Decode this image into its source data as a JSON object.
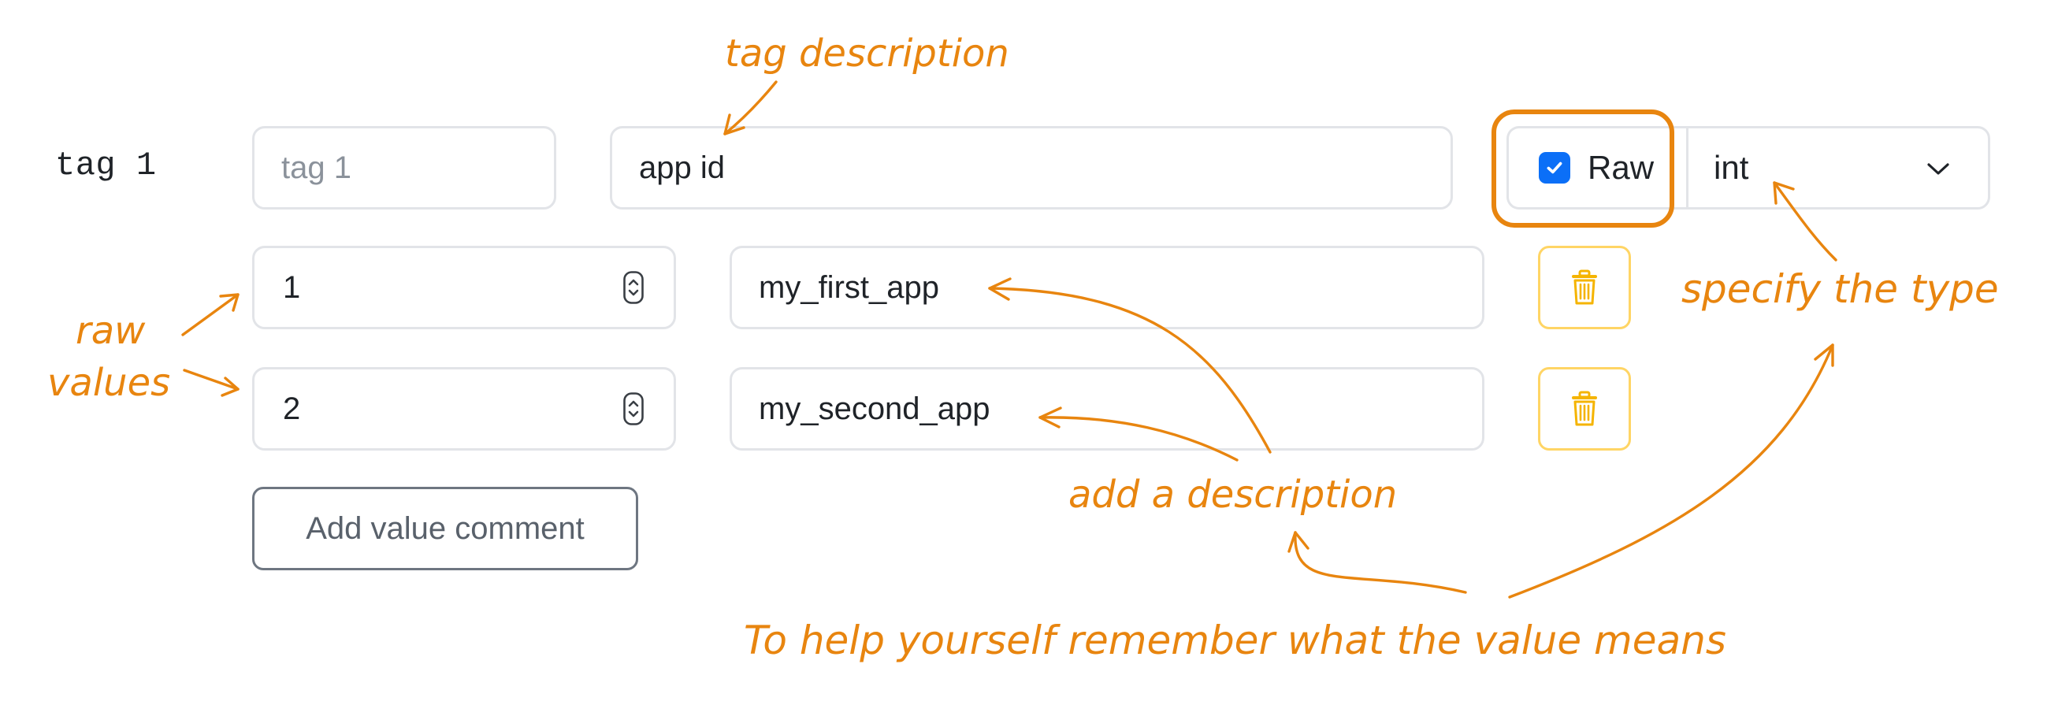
{
  "tag": {
    "label": "tag 1",
    "name_placeholder": "tag 1",
    "description_value": "app id",
    "raw_checked": true,
    "raw_label": "Raw",
    "type_value": "int"
  },
  "values": [
    {
      "raw": "1",
      "description": "my_first_app"
    },
    {
      "raw": "2",
      "description": "my_second_app"
    }
  ],
  "add_value_comment_label": "Add value comment",
  "annotations": {
    "tag_description": "tag description",
    "raw_values_line1": "raw",
    "raw_values_line2": "values",
    "specify_type": "specify the type",
    "add_description": "add a description",
    "help_remember": "To help yourself remember what the value means"
  },
  "colors": {
    "annotation": "#e8850f",
    "checkbox": "#0b6ff7",
    "delete_border": "#ffd565",
    "delete_icon": "#f5b400"
  },
  "icons": [
    "check-icon",
    "chevron-down-icon",
    "trash-icon",
    "stepper-icon"
  ]
}
